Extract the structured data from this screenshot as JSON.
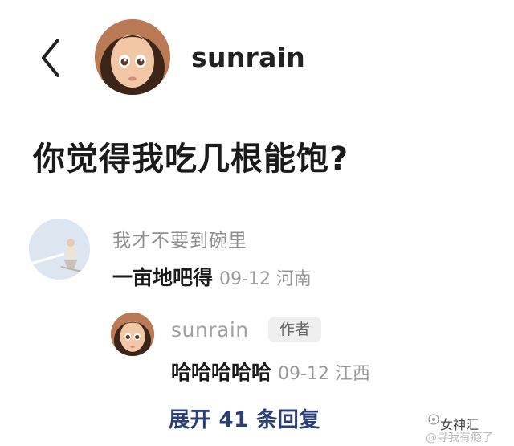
{
  "header": {
    "username": "sunrain"
  },
  "post": {
    "title": "你觉得我吃几根能饱?"
  },
  "comment": {
    "quote": "我才不要到碗里",
    "text": "一亩地吧得",
    "meta": "09-12 河南"
  },
  "reply": {
    "username": "sunrain",
    "badge": "作者",
    "text": "哈哈哈哈哈",
    "meta": "09-12 江西"
  },
  "expand": {
    "label": "展开 41 条回复"
  },
  "watermark": {
    "main": "女神汇",
    "sub": "@寻我有瘾了"
  },
  "colors": {
    "link": "#2a3f7a",
    "muted": "#9a9a9a",
    "badge_bg": "#efefef"
  }
}
